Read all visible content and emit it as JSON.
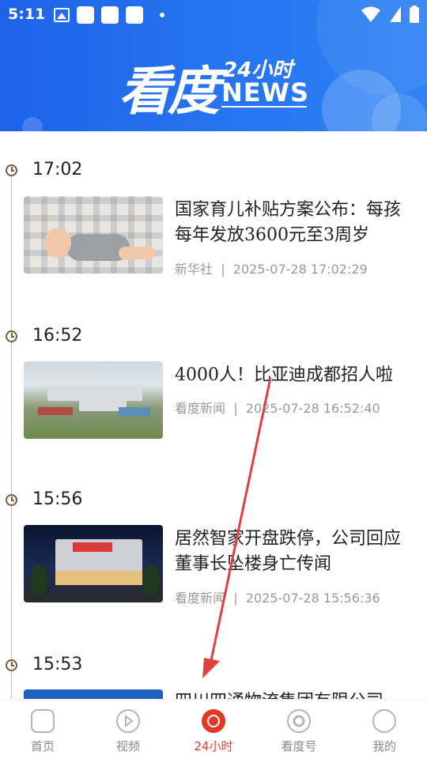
{
  "status_bar": {
    "time": "5:11"
  },
  "header": {
    "logo_cn": "看度",
    "logo_24": "24小时",
    "logo_news": "NEWS"
  },
  "feed": [
    {
      "slot_time": "17:02",
      "title": "国家育儿补贴方案公布：每孩每年发放3600元至3周岁",
      "source": "新华社",
      "datetime": "2025-07-28 17:02:29"
    },
    {
      "slot_time": "16:52",
      "title": "4000人！比亚迪成都招人啦",
      "source": "看度新闻",
      "datetime": "2025-07-28 16:52:40"
    },
    {
      "slot_time": "15:56",
      "title": "居然智家开盘跌停，公司回应董事长坠楼身亡传闻",
      "source": "看度新闻",
      "datetime": "2025-07-28 15:56:36"
    },
    {
      "slot_time": "15:53",
      "title": "四川四通物流集团有限公司",
      "source": "",
      "datetime": ""
    }
  ],
  "bottom_nav": [
    {
      "label": "首页",
      "icon": "home-icon",
      "active": false
    },
    {
      "label": "视频",
      "icon": "play-icon",
      "active": false
    },
    {
      "label": "24小时",
      "icon": "refresh-24-icon",
      "active": true
    },
    {
      "label": "看度号",
      "icon": "target-icon",
      "active": false
    },
    {
      "label": "我的",
      "icon": "user-icon",
      "active": false
    }
  ],
  "colors": {
    "header_blue": "#1d63ea",
    "accent_red": "#e03a26",
    "meta_gray": "#999999"
  }
}
